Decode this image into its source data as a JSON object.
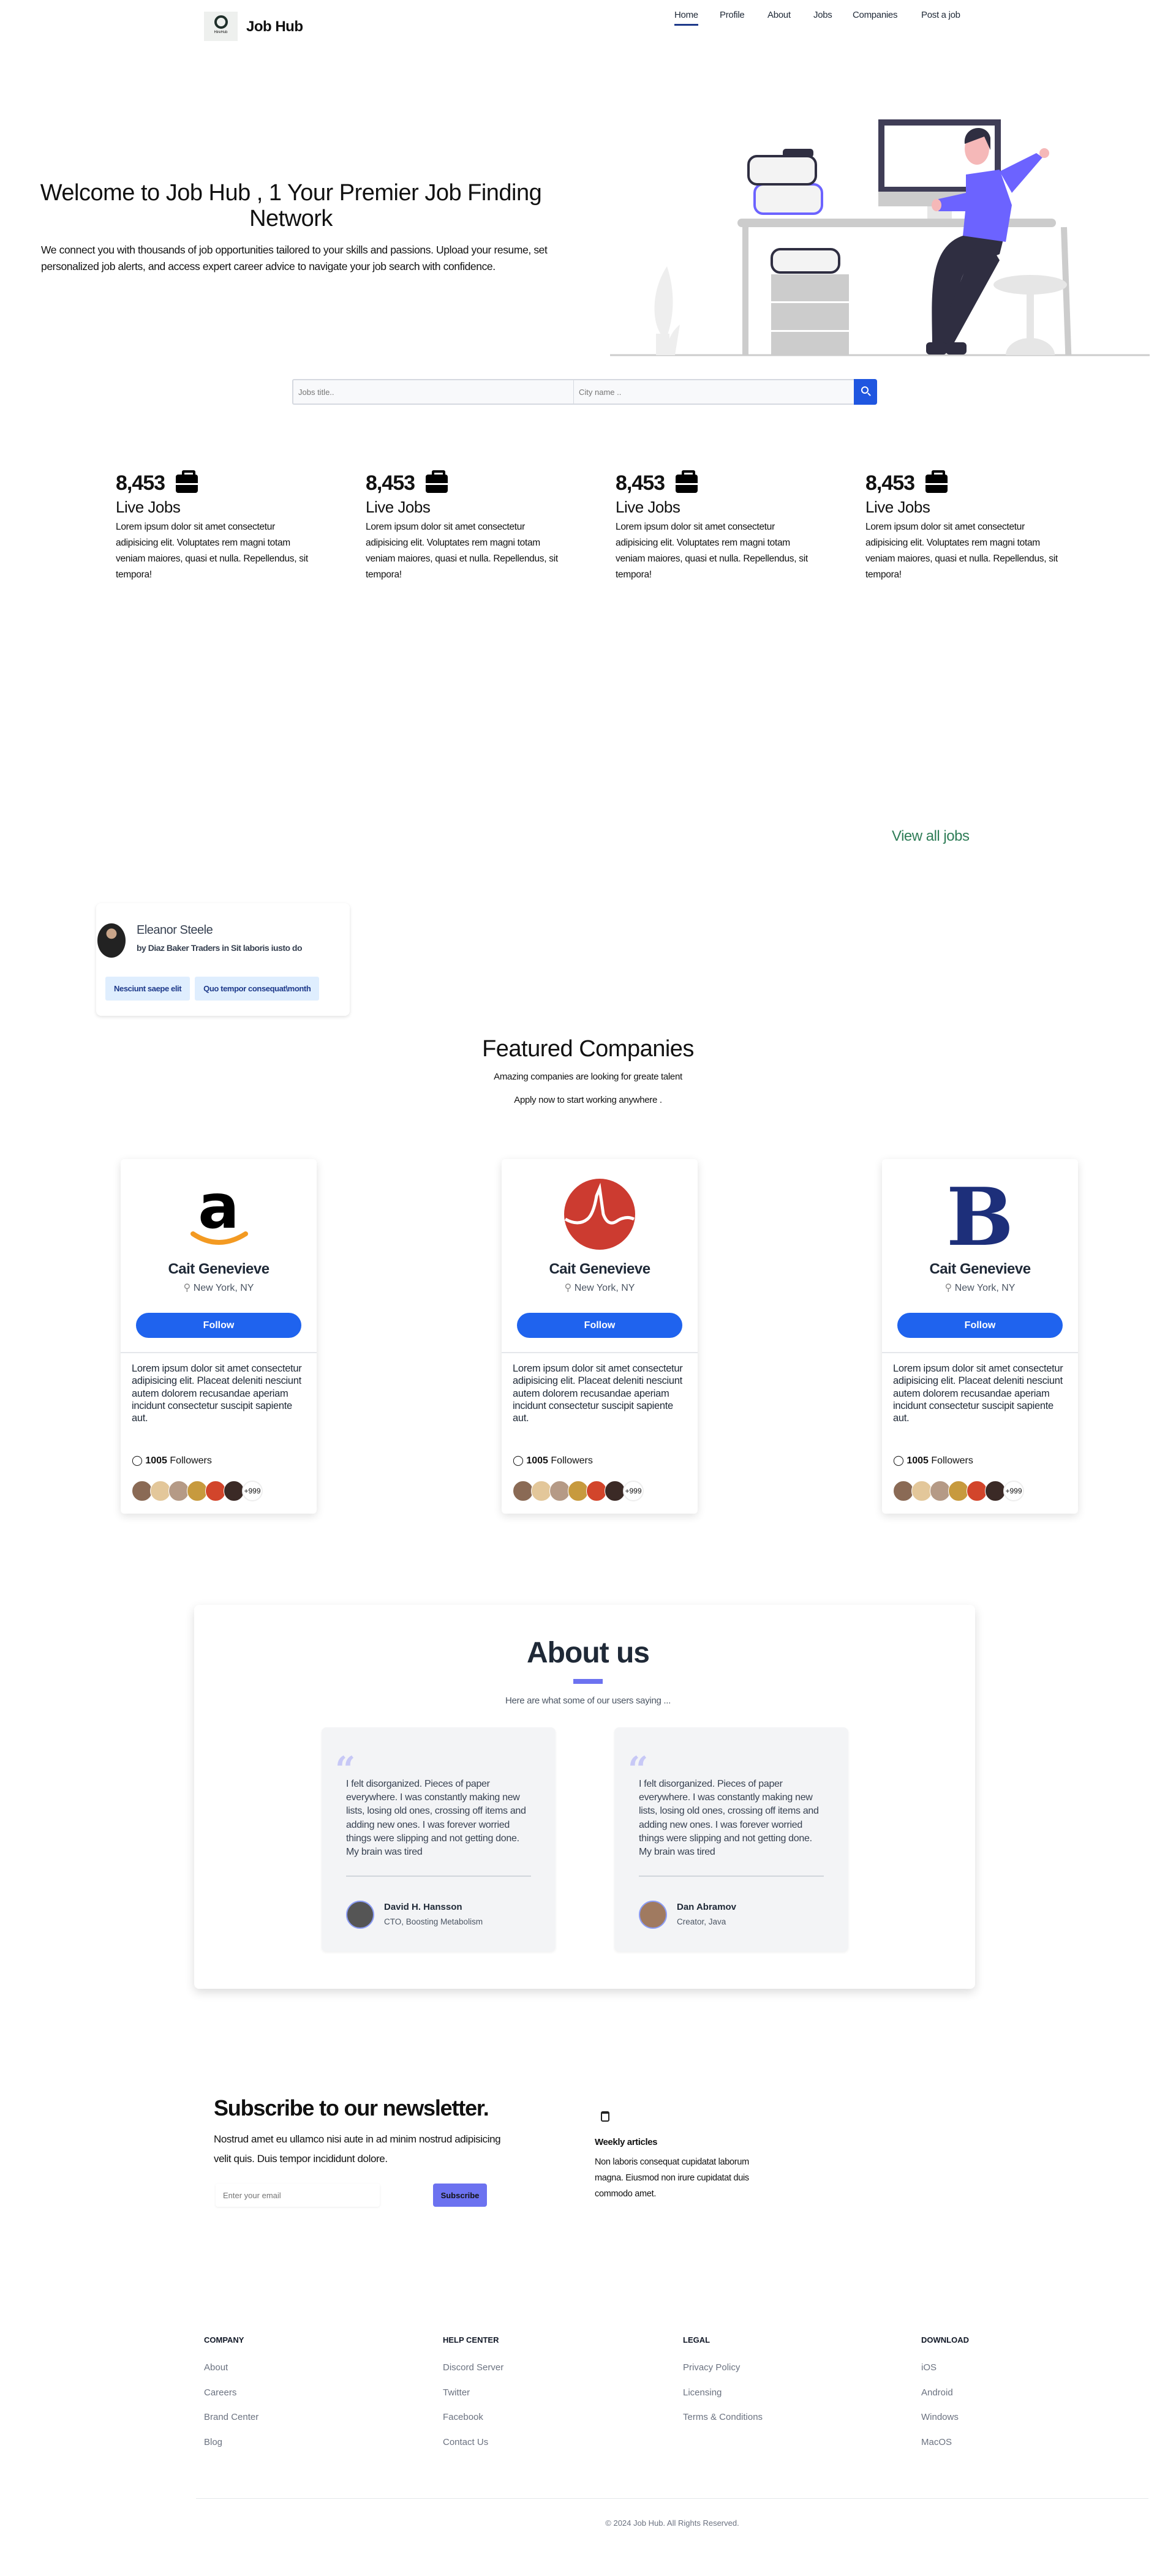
{
  "brand": {
    "name": "Job Hub",
    "logo_text": "HireHub"
  },
  "nav": {
    "items": [
      "Home",
      "Profile",
      "About",
      "Jobs",
      "Companies",
      "Post a job"
    ],
    "active": "Home"
  },
  "hero": {
    "title": "Welcome to Job Hub , 1 Your Premier Job Finding Network",
    "description": "We connect you with thousands of job opportunities tailored to your skills and passions. Upload your resume, set personalized job alerts, and access expert career advice to navigate your job search with confidence."
  },
  "search": {
    "title_placeholder": "Jobs title..",
    "city_placeholder": "City name ..",
    "button_icon": "search-icon"
  },
  "stats": [
    {
      "number": "8,453",
      "label": "Live Jobs",
      "icon": "briefcase-icon",
      "description": "Lorem ipsum dolor sit amet consectetur adipisicing elit. Voluptates rem magni totam veniam maiores, quasi et nulla. Repellendus, sit tempora!"
    },
    {
      "number": "8,453",
      "label": "Live Jobs",
      "icon": "briefcase-icon",
      "description": "Lorem ipsum dolor sit amet consectetur adipisicing elit. Voluptates rem magni totam veniam maiores, quasi et nulla. Repellendus, sit tempora!"
    },
    {
      "number": "8,453",
      "label": "Live Jobs",
      "icon": "briefcase-icon",
      "description": "Lorem ipsum dolor sit amet consectetur adipisicing elit. Voluptates rem magni totam veniam maiores, quasi et nulla. Repellendus, sit tempora!"
    },
    {
      "number": "8,453",
      "label": "Live Jobs",
      "icon": "briefcase-icon",
      "description": "Lorem ipsum dolor sit amet consectetur adipisicing elit. Voluptates rem magni totam veniam maiores, quasi et nulla. Repellendus, sit tempora!"
    }
  ],
  "view_all_jobs": "View all jobs",
  "job_card": {
    "name": "Eleanor Steele",
    "subtitle": "by Diaz Baker Traders in Sit laboris iusto do",
    "tags": [
      "Nesciunt saepe elit",
      "Quo tempor consequat\\month"
    ]
  },
  "featured": {
    "title": "Featured Companies",
    "subtitle1": "Amazing companies are looking for greate talent",
    "subtitle2": "Apply now to start working anywhere ."
  },
  "companies": [
    {
      "logo": "amazon-logo",
      "name": "Cait Genevieve",
      "location": "New York, NY",
      "follow_label": "Follow",
      "description": "Lorem ipsum dolor sit amet consectetur adipisicing elit. Placeat deleniti nesciunt autem dolorem recusandae aperiam incidunt consectetur suscipit sapiente aut.",
      "followers_count": "1005",
      "followers_label": "Followers",
      "more": "+999"
    },
    {
      "logo": "broadcom-logo",
      "name": "Cait Genevieve",
      "location": "New York, NY",
      "follow_label": "Follow",
      "description": "Lorem ipsum dolor sit amet consectetur adipisicing elit. Placeat deleniti nesciunt autem dolorem recusandae aperiam incidunt consectetur suscipit sapiente aut.",
      "followers_count": "1005",
      "followers_label": "Followers",
      "more": "+999"
    },
    {
      "logo": "b-logo",
      "name": "Cait Genevieve",
      "location": "New York, NY",
      "follow_label": "Follow",
      "description": "Lorem ipsum dolor sit amet consectetur adipisicing elit. Placeat deleniti nesciunt autem dolorem recusandae aperiam incidunt consectetur suscipit sapiente aut.",
      "followers_count": "1005",
      "followers_label": "Followers",
      "more": "+999"
    }
  ],
  "about": {
    "title": "About us",
    "subtitle": "Here are what some of our users saying ...",
    "testimonials": [
      {
        "text": "I felt disorganized. Pieces of paper everywhere. I was constantly making new lists, losing old ones, crossing off items and adding new ones. I was forever worried things were slipping and not getting done. My brain was tired",
        "name": "David H. Hansson",
        "role": "CTO, Boosting Metabolism"
      },
      {
        "text": "I felt disorganized. Pieces of paper everywhere. I was constantly making new lists, losing old ones, crossing off items and adding new ones. I was forever worried things were slipping and not getting done. My brain was tired",
        "name": "Dan Abramov",
        "role": "Creator, Java"
      }
    ]
  },
  "newsletter": {
    "title": "Subscribe to our newsletter.",
    "description": "Nostrud amet eu ullamco nisi aute in ad minim nostrud adipisicing velit quis. Duis tempor incididunt dolore.",
    "email_placeholder": "Enter your email",
    "button": "Subscribe",
    "feature_title": "Weekly articles",
    "feature_text": "Non laboris consequat cupidatat laborum magna. Eiusmod non irure cupidatat duis commodo amet."
  },
  "footer": {
    "columns": [
      {
        "heading": "COMPANY",
        "links": [
          "About",
          "Careers",
          "Brand Center",
          "Blog"
        ]
      },
      {
        "heading": "HELP CENTER",
        "links": [
          "Discord Server",
          "Twitter",
          "Facebook",
          "Contact Us"
        ]
      },
      {
        "heading": "LEGAL",
        "links": [
          "Privacy Policy",
          "Licensing",
          "Terms & Conditions"
        ]
      },
      {
        "heading": "DOWNLOAD",
        "links": [
          "iOS",
          "Android",
          "Windows",
          "MacOS"
        ]
      }
    ],
    "copyright": "© 2024 Job Hub. All Rights Reserved."
  },
  "colors": {
    "primary": "#1f63ee",
    "accent": "#6c72f0",
    "link_green": "#2f7d57",
    "tag_bg": "#dfeefe"
  }
}
